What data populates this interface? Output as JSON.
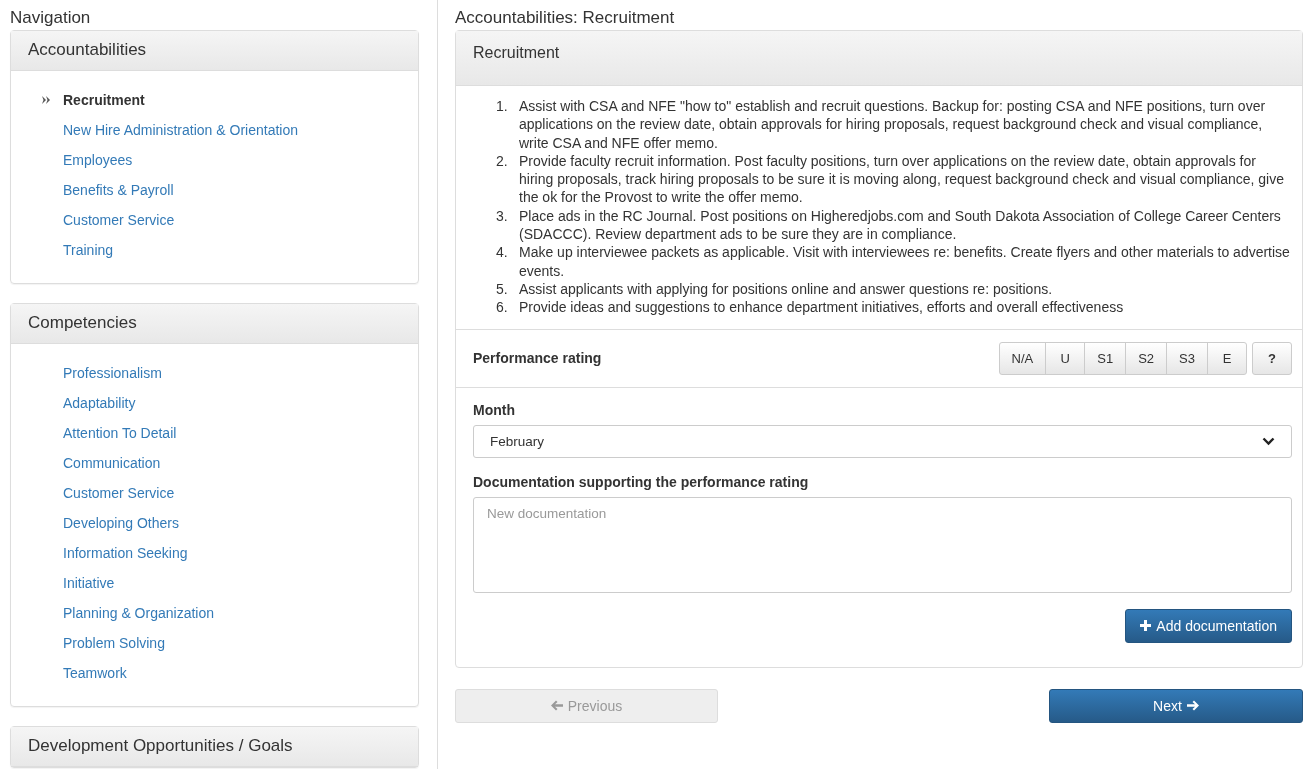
{
  "sidebar": {
    "title": "Navigation",
    "panels": [
      {
        "title": "Accountabilities",
        "items": [
          {
            "label": "Recruitment",
            "selected": true
          },
          {
            "label": "New Hire Administration & Orientation",
            "selected": false
          },
          {
            "label": "Employees",
            "selected": false
          },
          {
            "label": "Benefits & Payroll",
            "selected": false
          },
          {
            "label": "Customer Service",
            "selected": false
          },
          {
            "label": "Training",
            "selected": false
          }
        ]
      },
      {
        "title": "Competencies",
        "items": [
          {
            "label": "Professionalism",
            "selected": false
          },
          {
            "label": "Adaptability",
            "selected": false
          },
          {
            "label": "Attention To Detail",
            "selected": false
          },
          {
            "label": "Communication",
            "selected": false
          },
          {
            "label": "Customer Service",
            "selected": false
          },
          {
            "label": "Developing Others",
            "selected": false
          },
          {
            "label": "Information Seeking",
            "selected": false
          },
          {
            "label": "Initiative",
            "selected": false
          },
          {
            "label": "Planning & Organization",
            "selected": false
          },
          {
            "label": "Problem Solving",
            "selected": false
          },
          {
            "label": "Teamwork",
            "selected": false
          }
        ]
      },
      {
        "title": "Development Opportunities / Goals"
      }
    ]
  },
  "main": {
    "title": "Accountabilities: Recruitment",
    "panel_title": "Recruitment",
    "duties": [
      {
        "number": "1.",
        "text": "Assist with CSA and NFE \"how to\" establish and recruit questions. Backup for: posting CSA and NFE positions, turn over applications on the review date, obtain approvals for hiring proposals, request background check and visual compliance, write CSA and NFE offer memo."
      },
      {
        "number": "2.",
        "text": "Provide faculty recruit information. Post faculty positions, turn over applications on the review date, obtain approvals for hiring proposals, track hiring proposals to be sure it is moving along, request background check and visual compliance, give the ok for the Provost to write the offer memo."
      },
      {
        "number": "3.",
        "text": "Place ads in the RC Journal. Post positions on Higheredjobs.com and South Dakota Association of College Career Centers (SDACCC). Review department ads to be sure they are in compliance."
      },
      {
        "number": "4.",
        "text": "Make up interviewee packets as applicable. Visit with interviewees re: benefits. Create flyers and other materials to advertise events."
      },
      {
        "number": "5.",
        "text": "Assist applicants with applying for positions online and answer questions re: positions."
      },
      {
        "number": "6.",
        "text": "Provide ideas and suggestions to enhance department initiatives, efforts and overall effectiveness"
      }
    ],
    "rating": {
      "label": "Performance rating",
      "options": [
        {
          "label": "N/A",
          "selected": false
        },
        {
          "label": "U",
          "selected": false
        },
        {
          "label": "S1",
          "selected": false
        },
        {
          "label": "S2",
          "selected": false
        },
        {
          "label": "S3",
          "selected": false
        },
        {
          "label": "E",
          "selected": false
        }
      ],
      "help": "?"
    },
    "month": {
      "label": "Month",
      "value": "February"
    },
    "documentation": {
      "label": "Documentation supporting the performance rating",
      "placeholder": "New documentation"
    },
    "add_button": "Add documentation",
    "previous_button": "Previous",
    "next_button": "Next"
  }
}
